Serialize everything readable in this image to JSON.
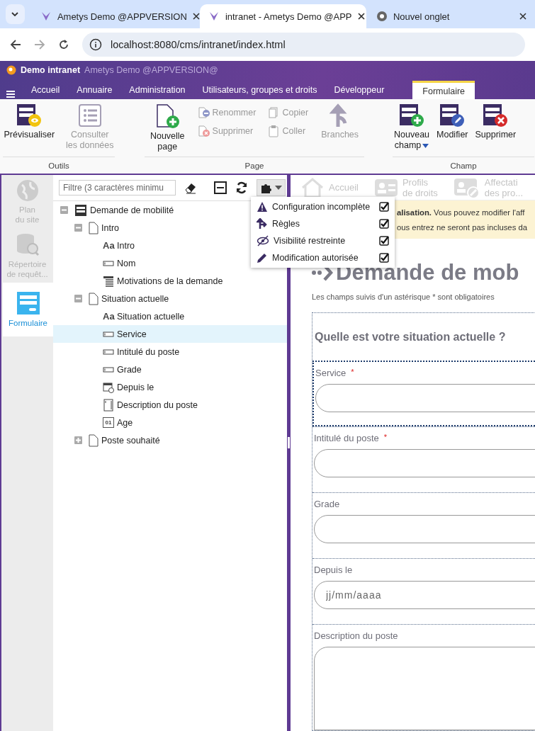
{
  "browser": {
    "tabs": [
      {
        "title": "Ametys Demo @APPVERSION",
        "selected": false
      },
      {
        "title": "intranet - Ametys Demo @APP",
        "selected": true
      },
      {
        "title": "Nouvel onglet",
        "selected": false
      }
    ],
    "url": "localhost:8080/cms/intranet/index.html"
  },
  "app": {
    "site": "Demo intranet",
    "product": "Ametys Demo @APPVERSION@"
  },
  "menu": [
    {
      "label": "Accueil",
      "selected": false
    },
    {
      "label": "Annuaire",
      "selected": false
    },
    {
      "label": "Administration",
      "selected": false
    },
    {
      "label": "Utilisateurs, groupes et droits",
      "selected": false
    },
    {
      "label": "Développeur",
      "selected": false
    },
    {
      "label": "Formulaire",
      "selected": true
    }
  ],
  "ribbon": {
    "groups": [
      {
        "title": "Outils",
        "items": [
          {
            "kind": "large",
            "label": "Prévisualiser",
            "disabled": false
          },
          {
            "kind": "large",
            "label": "Consulter\nles données",
            "disabled": true
          }
        ]
      },
      {
        "title": "Page",
        "items": [
          {
            "kind": "large",
            "label": "Nouvelle\npage",
            "disabled": false
          },
          {
            "kind": "stack",
            "buttons": [
              {
                "label": "Renommer",
                "disabled": true
              },
              {
                "label": "Supprimer",
                "disabled": true
              }
            ]
          },
          {
            "kind": "stack",
            "buttons": [
              {
                "label": "Copier",
                "disabled": true
              },
              {
                "label": "Coller",
                "disabled": true
              }
            ]
          },
          {
            "kind": "large",
            "label": "Branches",
            "disabled": true
          }
        ]
      },
      {
        "title": "Champ",
        "items": [
          {
            "kind": "large",
            "label": "Nouveau\nchamp",
            "disabled": false,
            "menu": true
          },
          {
            "kind": "large",
            "label": "Modifier",
            "disabled": false
          },
          {
            "kind": "large",
            "label": "Supprimer",
            "disabled": false
          }
        ]
      }
    ]
  },
  "sidebar": {
    "items": [
      {
        "label": "Plan\ndu site",
        "disabled": true,
        "selected": false
      },
      {
        "label": "Répertoire\nde requêt...",
        "disabled": true,
        "selected": false
      },
      {
        "label": "Formulaire",
        "disabled": false,
        "selected": true
      }
    ]
  },
  "tree": {
    "filter": {
      "placeholder": "Filtre (3 caractères minimu"
    },
    "menu": {
      "open": true,
      "items": [
        {
          "label": "Configuration incomplète",
          "checked": true
        },
        {
          "label": "Règles",
          "checked": true
        },
        {
          "label": "Visibilité restreinte",
          "checked": true
        },
        {
          "label": "Modification autorisée",
          "checked": true
        }
      ]
    },
    "nodes": [
      {
        "label": "Demande de mobilité",
        "kind": "form",
        "expanded": true,
        "selected": false,
        "children": [
          {
            "label": "Intro",
            "kind": "page",
            "expanded": true,
            "selected": false,
            "children": [
              {
                "label": "Intro",
                "kind": "title",
                "glyph": "Aa",
                "selected": false
              },
              {
                "label": "Nom",
                "kind": "text",
                "selected": false
              },
              {
                "label": "Motivations de la demande",
                "kind": "textarea",
                "selected": false
              }
            ]
          },
          {
            "label": "Situation actuelle",
            "kind": "page",
            "expanded": true,
            "selected": false,
            "children": [
              {
                "label": "Situation actuelle",
                "kind": "title",
                "glyph": "Aa",
                "selected": false
              },
              {
                "label": "Service",
                "kind": "text",
                "selected": true
              },
              {
                "label": "Intitulé du poste",
                "kind": "text",
                "selected": false
              },
              {
                "label": "Grade",
                "kind": "text",
                "selected": false
              },
              {
                "label": "Depuis le",
                "kind": "date",
                "selected": false
              },
              {
                "label": "Description du poste",
                "kind": "richtext",
                "selected": false
              },
              {
                "label": "Age",
                "kind": "number",
                "glyph": "01",
                "selected": false
              }
            ]
          },
          {
            "label": "Poste souhaité",
            "kind": "page",
            "expanded": false,
            "selected": false
          }
        ]
      }
    ]
  },
  "preview": {
    "toolbar": [
      {
        "label": "Accueil",
        "disabled": true
      },
      {
        "label": "Profils\nde droits",
        "disabled": true
      },
      {
        "label": "Affectati\ndes pro...",
        "disabled": true
      }
    ],
    "banner": [
      "**alisation.** Vous pouvez modifier l'aff",
      "ous entrez ne seront pas incluses da"
    ],
    "title": "Demande de mob",
    "note": "Les champs suivis d'un astérisque * sont obligatoires",
    "section": "Quelle est votre situation actuelle ?",
    "fields": [
      {
        "label": "Service",
        "required_mark": "*",
        "kind": "text",
        "selected": true
      },
      {
        "label": "Intitulé du poste",
        "required_mark": "*",
        "kind": "text",
        "selected": false
      },
      {
        "label": "Grade",
        "kind": "text",
        "selected": false
      },
      {
        "label": "Depuis le",
        "kind": "date",
        "placeholder": "jj/mm/aaaa",
        "selected": false
      },
      {
        "label": "Description du poste",
        "kind": "textarea",
        "selected": false
      }
    ]
  }
}
